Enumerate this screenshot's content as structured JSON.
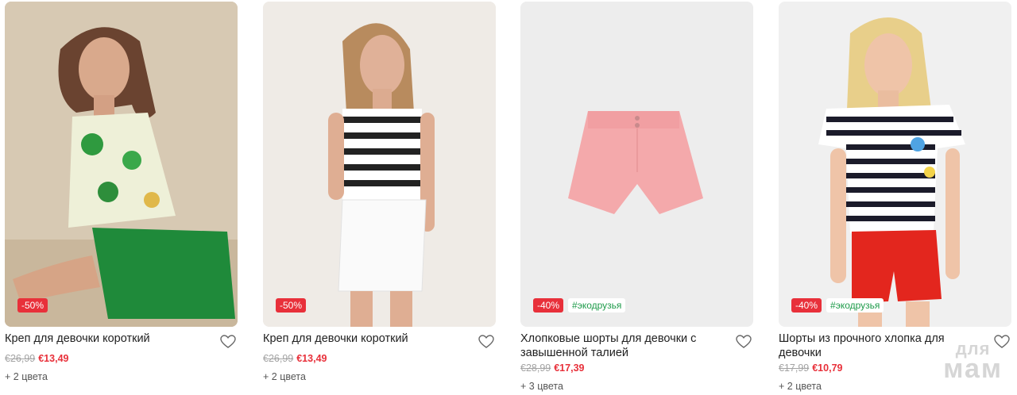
{
  "products": [
    {
      "title": "Креп для девочки короткий",
      "old_price": "€26,99",
      "new_price": "€13,49",
      "discount": "-50%",
      "eco": "",
      "colors": "+ 2 цвета",
      "image_bg": "#d8cbb7",
      "image_alt": "girl-in-floral-top-green-shorts"
    },
    {
      "title": "Креп для девочки короткий",
      "old_price": "€26,99",
      "new_price": "€13,49",
      "discount": "-50%",
      "eco": "",
      "colors": "+ 2 цвета",
      "image_bg": "#efebe6",
      "image_alt": "girl-in-striped-top-white-shorts"
    },
    {
      "title": "Хлопковые шорты для девочки с завышенной талией",
      "old_price": "€28,99",
      "new_price": "€17,39",
      "discount": "-40%",
      "eco": "#экодрузья",
      "colors": "+ 3 цвета",
      "image_bg": "#eeeeee",
      "image_alt": "pink-shorts"
    },
    {
      "title": "Шорты из прочного хлопка для девочки",
      "old_price": "€17,99",
      "new_price": "€10,79",
      "discount": "-40%",
      "eco": "#экодрузья",
      "colors": "+ 2 цвета",
      "image_bg": "#f0f0f0",
      "image_alt": "girl-in-striped-tee-red-shorts"
    }
  ],
  "watermark": {
    "line1": "для",
    "line2": "мам"
  },
  "colors": {
    "sale": "#e8303a",
    "eco": "#1e9b4a",
    "old_price": "#a3a3a3"
  }
}
